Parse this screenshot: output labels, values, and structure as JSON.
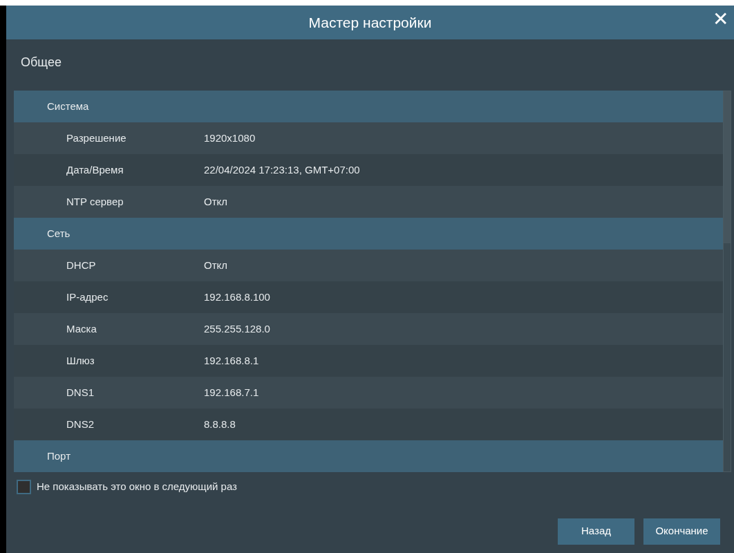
{
  "window": {
    "title": "Мастер настройки",
    "close": "✕"
  },
  "section_title": "Общее",
  "groups": [
    {
      "name": "Система",
      "rows": [
        {
          "label": "Разрешение",
          "value": "1920x1080"
        },
        {
          "label": "Дата/Время",
          "value": "22/04/2024 17:23:13, GMT+07:00"
        },
        {
          "label": "NTP сервер",
          "value": "Откл"
        }
      ]
    },
    {
      "name": "Сеть",
      "rows": [
        {
          "label": "DHCP",
          "value": "Откл"
        },
        {
          "label": "IP-адрес",
          "value": "192.168.8.100"
        },
        {
          "label": "Маска",
          "value": "255.255.128.0"
        },
        {
          "label": "Шлюз",
          "value": "192.168.8.1"
        },
        {
          "label": "DNS1",
          "value": "192.168.7.1"
        },
        {
          "label": "DNS2",
          "value": "8.8.8.8"
        }
      ]
    },
    {
      "name": "Порт"
    }
  ],
  "dont_show": {
    "label": "Не показывать это окно в следующий раз",
    "checked": false
  },
  "buttons": [
    "Назад",
    "Окончание"
  ]
}
